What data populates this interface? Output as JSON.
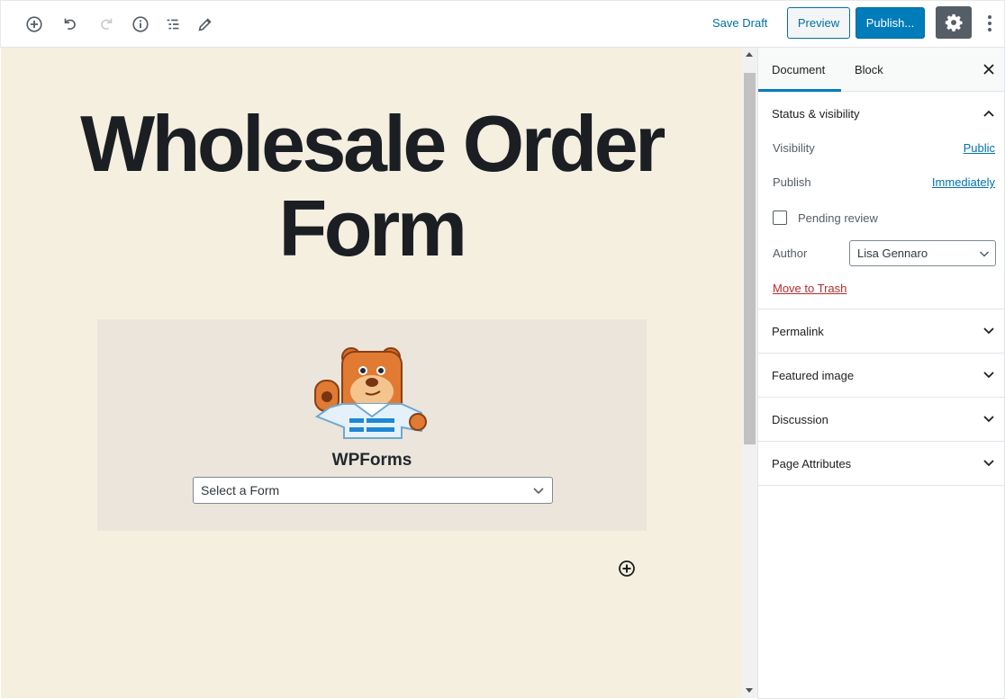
{
  "toolbar": {
    "icons": [
      "add-block-icon",
      "undo-icon",
      "redo-icon",
      "info-icon",
      "list-view-icon",
      "edit-tools-icon"
    ],
    "save_draft": "Save Draft",
    "preview": "Preview",
    "publish": "Publish...",
    "settings_icon": "gear-icon",
    "more_icon": "more-vertical-icon"
  },
  "editor": {
    "title": "Wholesale Order Form",
    "block": {
      "name": "WPForms",
      "select_placeholder": "Select a Form"
    }
  },
  "sidebar": {
    "tabs": [
      {
        "label": "Document",
        "active": true
      },
      {
        "label": "Block",
        "active": false
      }
    ],
    "status_panel": {
      "title": "Status & visibility",
      "expanded": true,
      "visibility_label": "Visibility",
      "visibility_value": "Public",
      "publish_label": "Publish",
      "publish_value": "Immediately",
      "pending_review_label": "Pending review",
      "pending_review_checked": false,
      "author_label": "Author",
      "author_value": "Lisa Gennaro",
      "trash_label": "Move to Trash"
    },
    "panels": [
      {
        "title": "Permalink"
      },
      {
        "title": "Featured image"
      },
      {
        "title": "Discussion"
      },
      {
        "title": "Page Attributes"
      }
    ]
  },
  "colors": {
    "accent": "#007cba",
    "canvas_bg": "#f5efe0",
    "block_bg": "#ebe5dc",
    "trash": "#b32d2e"
  }
}
